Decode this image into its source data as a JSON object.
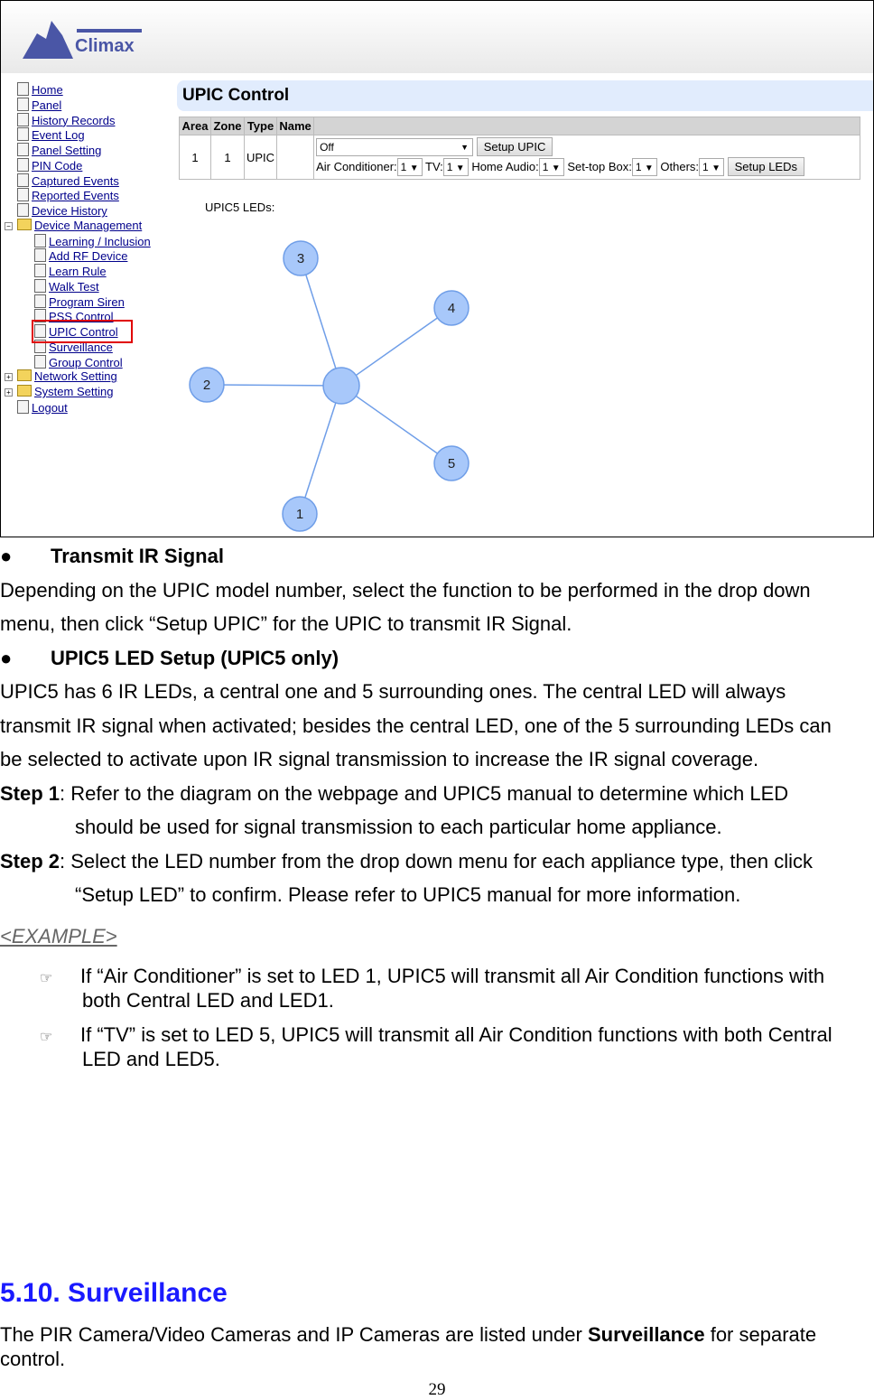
{
  "app": {
    "logo_text": "Climax",
    "page_title": "UPIC Control"
  },
  "nav": [
    {
      "label": "Home",
      "level": 0
    },
    {
      "label": "Panel",
      "level": 0
    },
    {
      "label": "History Records",
      "level": 0
    },
    {
      "label": "Event Log",
      "level": 0
    },
    {
      "label": "Panel Setting",
      "level": 0
    },
    {
      "label": "PIN Code",
      "level": 0
    },
    {
      "label": "Captured Events",
      "level": 0
    },
    {
      "label": "Reported Events",
      "level": 0
    },
    {
      "label": "Device History",
      "level": 0
    },
    {
      "label": "Device Management",
      "level": 0,
      "folder": true,
      "expanded": true
    },
    {
      "label": "Learning / Inclusion",
      "level": 1
    },
    {
      "label": "Add RF Device",
      "level": 1
    },
    {
      "label": "Learn Rule",
      "level": 1
    },
    {
      "label": "Walk Test",
      "level": 1
    },
    {
      "label": "Program Siren",
      "level": 1
    },
    {
      "label": "PSS Control",
      "level": 1
    },
    {
      "label": "UPIC Control",
      "level": 1,
      "highlighted": true
    },
    {
      "label": "Surveillance",
      "level": 1
    },
    {
      "label": "Group Control",
      "level": 1
    },
    {
      "label": "Network Setting",
      "level": 0,
      "folder": true
    },
    {
      "label": "System Setting",
      "level": 0,
      "folder": true
    },
    {
      "label": "Logout",
      "level": 0
    }
  ],
  "table": {
    "headers": [
      "Area",
      "Zone",
      "Type",
      "Name",
      ""
    ],
    "row": {
      "area": "1",
      "zone": "1",
      "type": "UPIC",
      "name": "",
      "function": "Off",
      "setup_upic": "Setup UPIC",
      "ac_label": "Air Conditioner:",
      "ac": "1",
      "tv_label": "TV:",
      "tv": "1",
      "audio_label": "Home Audio:",
      "audio": "1",
      "stb_label": "Set-top Box:",
      "stb": "1",
      "others_label": "Others:",
      "others": "1",
      "setup_leds": "Setup LEDs"
    }
  },
  "leds": {
    "label": "UPIC5 LEDs:",
    "numbers": [
      "1",
      "2",
      "3",
      "4",
      "5"
    ]
  },
  "doc": {
    "h1": "Transmit IR Signal",
    "p1a": "Depending on the UPIC model number, select the function to be performed in the drop down",
    "p1b": "menu, then click “Setup UPIC” for the UPIC to transmit IR Signal.",
    "h2": "UPIC5 LED Setup (UPIC5 only)",
    "p2a": "UPIC5 has 6 IR LEDs, a central one and 5 surrounding ones. The central LED will always",
    "p2b": "transmit IR signal when activated; besides the central LED, one of the 5 surrounding LEDs can",
    "p2c": "be selected to activate upon IR signal transmission to increase the IR signal coverage.",
    "s1": "Step 1",
    "s1a": ": Refer to the diagram on the webpage and UPIC5 manual to determine which LED",
    "s1b": "should be used for signal transmission to each particular home appliance.",
    "s2": "Step 2",
    "s2a": ": Select the LED number from the drop down menu for each appliance type, then click",
    "s2b": "“Setup LED” to confirm. Please refer to UPIC5 manual for more information.",
    "example": "<EXAMPLE>",
    "e1a": "If “Air Conditioner” is set to LED 1, UPIC5 will transmit all Air Condition functions with",
    "e1b": "both Central LED and LED1.",
    "e2a": "If “TV” is set to LED 5, UPIC5 will transmit all Air Condition functions with both Central",
    "e2b": "LED and LED5.",
    "section": "5.10. Surveillance",
    "s3a": "The PIR Camera/Video Cameras and IP Cameras are listed under ",
    "s3b": "Surveillance",
    "s3c": " for separate",
    "s3d": "control.",
    "page": "29"
  }
}
